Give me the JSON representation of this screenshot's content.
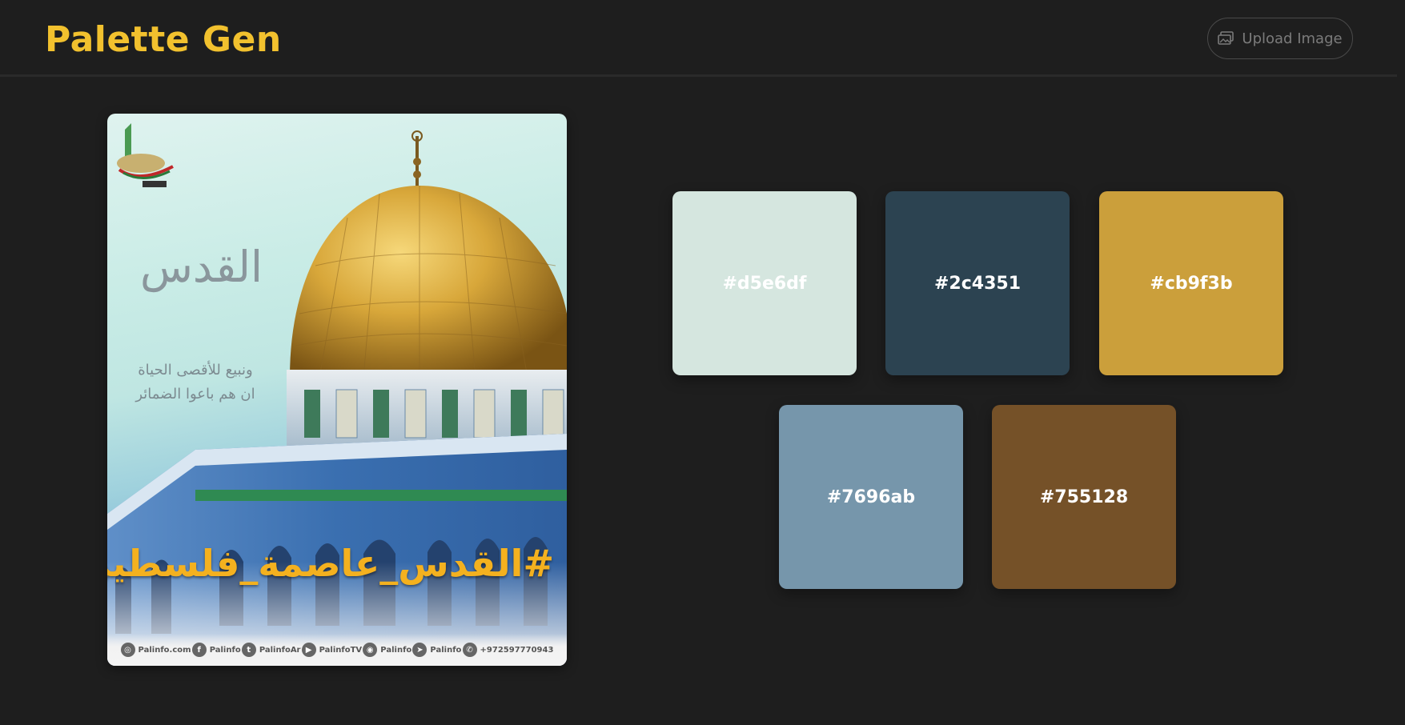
{
  "header": {
    "title": "Palette Gen",
    "upload_label": "Upload Image",
    "upload_icon": "image-upload-icon"
  },
  "image": {
    "hashtag": "#القدس_عاصمة_فلسطين",
    "calligraphy": "القدس",
    "verse_line_1": "ونبيع للأقصى الحياة",
    "verse_line_2": "ان هم باعوا الضمائر",
    "social": [
      {
        "icon": "globe-icon",
        "glyph": "◎",
        "label": "Palinfo.com"
      },
      {
        "icon": "facebook-icon",
        "glyph": "f",
        "label": "Palinfo"
      },
      {
        "icon": "twitter-icon",
        "glyph": "t",
        "label": "PalinfoAr"
      },
      {
        "icon": "youtube-icon",
        "glyph": "▶",
        "label": "PalinfoTV"
      },
      {
        "icon": "instagram-icon",
        "glyph": "◉",
        "label": "Palinfo"
      },
      {
        "icon": "telegram-icon",
        "glyph": "➤",
        "label": "Palinfo"
      },
      {
        "icon": "whatsapp-icon",
        "glyph": "✆",
        "label": "+972597770943"
      }
    ]
  },
  "palette": [
    {
      "hex": "#d5e6df"
    },
    {
      "hex": "#2c4351"
    },
    {
      "hex": "#cb9f3b"
    },
    {
      "hex": "#7696ab"
    },
    {
      "hex": "#755128"
    }
  ],
  "colors": {
    "background": "#1e1e1e",
    "accent": "#f2c12e"
  }
}
